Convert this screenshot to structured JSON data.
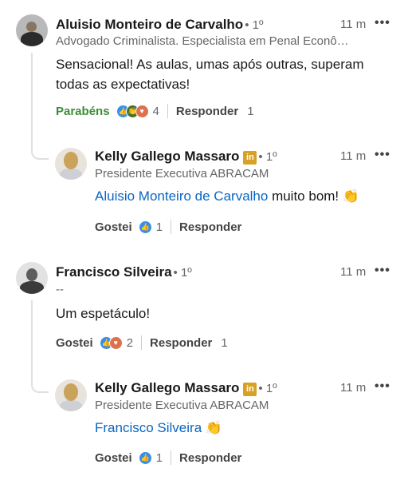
{
  "comments": [
    {
      "name": "Aluisio Monteiro de Carvalho",
      "degree": "• 1º",
      "headline": "Advogado Criminalista. Especialista em Penal Econô…",
      "time": "11 m",
      "more": "•••",
      "text": "Sensacional! As aulas, umas após outras, superam todas as expectativas!",
      "reaction_label": "Parabéns",
      "reaction_count": "4",
      "reply_label": "Responder",
      "reply_count": "1",
      "reply": {
        "name": "Kelly Gallego Massaro",
        "badge": "in",
        "degree": "• 1º",
        "headline": "Presidente Executiva ABRACAM",
        "time": "11 m",
        "more": "•••",
        "mention": "Aluisio Monteiro de Carvalho",
        "text": " muito bom! 👏",
        "reaction_label": "Gostei",
        "reaction_count": "1",
        "reply_label": "Responder"
      }
    },
    {
      "name": "Francisco Silveira",
      "degree": "• 1º",
      "headline": "--",
      "time": "11 m",
      "more": "•••",
      "text": "Um espetáculo!",
      "reaction_label": "Gostei",
      "reaction_count": "2",
      "reply_label": "Responder",
      "reply_count": "1",
      "reply": {
        "name": "Kelly Gallego Massaro",
        "badge": "in",
        "degree": "• 1º",
        "headline": "Presidente Executiva ABRACAM",
        "time": "11 m",
        "more": "•••",
        "mention": "Francisco Silveira",
        "text": " 👏",
        "reaction_label": "Gostei",
        "reaction_count": "1",
        "reply_label": "Responder"
      }
    }
  ],
  "icons": {
    "like": "like-reaction-icon",
    "celebrate": "celebrate-reaction-icon",
    "love": "love-reaction-icon"
  },
  "colors": {
    "mention": "#0a66c2",
    "celebrate_label": "#3d8b37",
    "like": "#378fe9",
    "love": "#df704d",
    "celebrate": "#44712e",
    "linkedin_badge": "#d8a024"
  }
}
